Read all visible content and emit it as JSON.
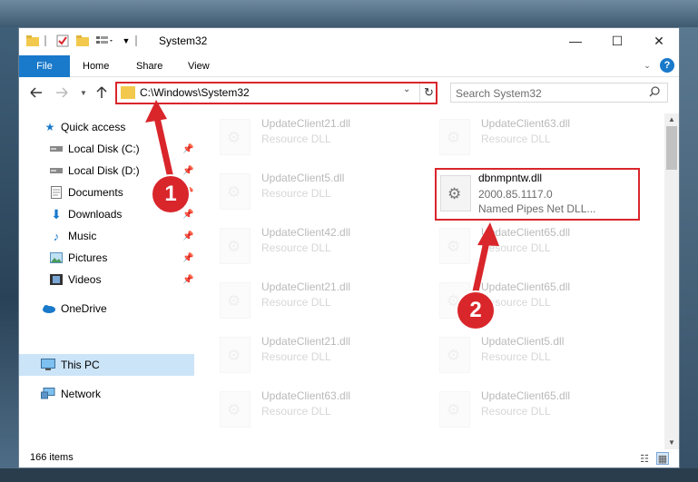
{
  "window": {
    "title": "System32",
    "controls": {
      "minimize": "—",
      "maximize": "☐",
      "close": "✕"
    }
  },
  "ribbon": {
    "file": "File",
    "tabs": [
      "Home",
      "Share",
      "View"
    ],
    "help": "?"
  },
  "address": {
    "path": "C:\\Windows\\System32",
    "search_placeholder": "Search System32"
  },
  "nav": {
    "items": [
      {
        "label": "Quick access",
        "icon": "star-icon"
      },
      {
        "label": "Local Disk (C:)",
        "icon": "drive-icon",
        "pinned": true
      },
      {
        "label": "Local Disk (D:)",
        "icon": "drive-icon",
        "pinned": true
      },
      {
        "label": "Documents",
        "icon": "documents-icon",
        "pinned": true
      },
      {
        "label": "Downloads",
        "icon": "downloads-icon",
        "pinned": true
      },
      {
        "label": "Music",
        "icon": "music-icon",
        "pinned": true
      },
      {
        "label": "Pictures",
        "icon": "pictures-icon",
        "pinned": true
      },
      {
        "label": "Videos",
        "icon": "videos-icon",
        "pinned": true
      },
      {
        "label": "OneDrive",
        "icon": "cloud-icon"
      },
      {
        "label": "This PC",
        "icon": "computer-icon",
        "selected": true
      },
      {
        "label": "Network",
        "icon": "network-icon"
      }
    ]
  },
  "files": {
    "left": [
      {
        "name": "UpdateClient21.dll",
        "type": "Resource DLL"
      },
      {
        "name": "UpdateClient5.dll",
        "type": "Resource DLL"
      },
      {
        "name": "UpdateClient42.dll",
        "type": "Resource DLL"
      },
      {
        "name": "UpdateClient21.dll",
        "type": "Resource DLL"
      },
      {
        "name": "UpdateClient21.dll",
        "type": "Resource DLL"
      },
      {
        "name": "UpdateClient63.dll",
        "type": "Resource DLL"
      }
    ],
    "right": [
      {
        "name": "UpdateClient63.dll",
        "type": "Resource DLL"
      },
      {
        "name": "UpdateClient65.dll",
        "type": "Resource DLL"
      },
      {
        "name": "UpdateClient65.dll",
        "type": "Resource DLL"
      },
      {
        "name": "UpdateClient5.dll",
        "type": "Resource DLL"
      },
      {
        "name": "UpdateClient65.dll",
        "type": "Resource DLL"
      }
    ],
    "highlighted": {
      "name": "dbnmpntw.dll",
      "version": "2000.85.1117.0",
      "description": "Named Pipes Net DLL..."
    }
  },
  "status": {
    "count": "166 items"
  },
  "annotations": {
    "step1": "1",
    "step2": "2",
    "color": "#d9262b"
  }
}
